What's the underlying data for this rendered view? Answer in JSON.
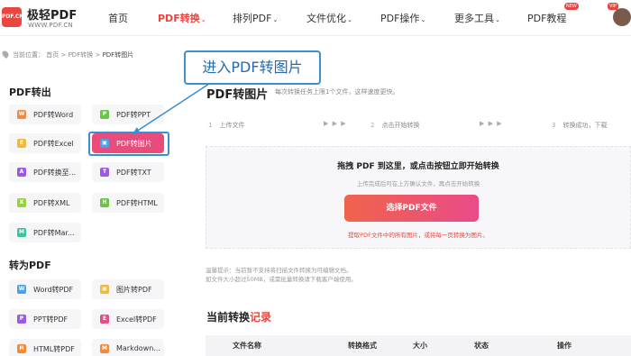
{
  "header": {
    "logo_icon_text": "PDF.CN",
    "logo_name": "极轻PDF",
    "logo_url": "WWW.PDF.CN",
    "nav": [
      {
        "label": "首页",
        "caret": ""
      },
      {
        "label": "PDF转换",
        "caret": "⌄"
      },
      {
        "label": "排列PDF",
        "caret": "⌄"
      },
      {
        "label": "文件优化",
        "caret": "⌄"
      },
      {
        "label": "PDF操作",
        "caret": "⌄"
      },
      {
        "label": "更多工具",
        "caret": "⌄"
      },
      {
        "label": "PDF教程",
        "caret": ""
      }
    ],
    "badge_new": "NEW",
    "badge_vip": "VIP"
  },
  "breadcrumb": {
    "prefix": "当前位置：",
    "home": "首页",
    "sep": ">",
    "parent": "PDF转换",
    "current": "PDF转图片"
  },
  "callout": "进入PDF转图片",
  "sidebar": {
    "section1": "PDF转出",
    "tools1": [
      {
        "label": "PDF转Word",
        "icon": "W",
        "color": "#f08a3e"
      },
      {
        "label": "PDF转PPT",
        "icon": "P",
        "color": "#6cc24a"
      },
      {
        "label": "PDF转Excel",
        "icon": "E",
        "color": "#f0b93e"
      },
      {
        "label": "PDF转图片",
        "icon": "▣",
        "color": "#4aa3e6"
      },
      {
        "label": "PDF转换至...",
        "icon": "A",
        "color": "#9a5ae6"
      },
      {
        "label": "PDF转TXT",
        "icon": "T",
        "color": "#9a5ae6"
      },
      {
        "label": "PDF转XML",
        "icon": "X",
        "color": "#9ad13e"
      },
      {
        "label": "PDF转HTML",
        "icon": "H",
        "color": "#6cc24a"
      },
      {
        "label": "PDF转Mar...",
        "icon": "M",
        "color": "#3ec1a0"
      }
    ],
    "section2": "转为PDF",
    "tools2": [
      {
        "label": "Word转PDF",
        "icon": "W",
        "color": "#4aa3e6"
      },
      {
        "label": "图片转PDF",
        "icon": "▣",
        "color": "#f0b93e"
      },
      {
        "label": "PPT转PDF",
        "icon": "P",
        "color": "#9a5ae6"
      },
      {
        "label": "Excel转PDF",
        "icon": "E",
        "color": "#e94b8a"
      },
      {
        "label": "HTML转PDF",
        "icon": "H",
        "color": "#f08a3e"
      },
      {
        "label": "Markdown...",
        "icon": "M",
        "color": "#f08a3e"
      }
    ]
  },
  "main": {
    "title": "PDF转图片",
    "subtitle": "每次转换任务上限1个文件，这样速度更快。",
    "steps": [
      {
        "num": "1",
        "label": "上传文件"
      },
      {
        "num": "2",
        "label": "点击开始转换"
      },
      {
        "num": "3",
        "label": "转换成功，下载"
      }
    ],
    "step_arrows": "▶ ▶ ▶",
    "upload": {
      "title": "拖拽 PDF 到这里，或点击按钮立即开始转换",
      "subtitle": "上传完成后可在上方确认文件，再点击开始转换",
      "button": "选择PDF文件",
      "note": "提取PDF文件中的所有图片，或将每一页转换为图片。"
    },
    "tips": [
      "温馨提示：当前暂不支持将扫描文件转换为可编辑文档。",
      "如文件大小超过50MB，或需批量转换请下载客户端使用。"
    ],
    "records": {
      "title": "当前转换",
      "title_hl": "记录",
      "columns": [
        "文件名称",
        "转换格式",
        "大小",
        "状态",
        "操作"
      ]
    }
  },
  "colors": {
    "accent": "#e9463f",
    "active_tool": "#e94b7c",
    "annotation": "#3b8fd1"
  }
}
